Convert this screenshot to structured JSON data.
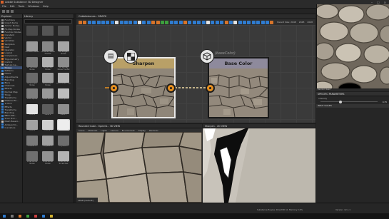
{
  "window": {
    "title": "Adobe Substance 3D Designer",
    "menu": [
      "File",
      "Edit",
      "Tools",
      "Windows",
      "Help"
    ]
  },
  "explorer": {
    "tab_label": "Explorer",
    "items": [
      {
        "label": "Functions",
        "color": "#8a8a8a"
      },
      {
        "label": "Graph Items",
        "color": "#8a8a8a"
      },
      {
        "label": "Atomic Nodes",
        "color": "#c0c0c0"
      },
      {
        "label": "FX-Map Nodes",
        "color": "#c0c0c0"
      },
      {
        "label": "Function Nodes",
        "color": "#c0c0c0"
      },
      {
        "label": "Constant",
        "color": "#d6742a"
      },
      {
        "label": "Vector",
        "color": "#d6742a"
      },
      {
        "label": "Variables",
        "color": "#d6742a"
      },
      {
        "label": "Samplers",
        "color": "#d6742a"
      },
      {
        "label": "Cast",
        "color": "#d6742a"
      },
      {
        "label": "Operator",
        "color": "#d6742a"
      },
      {
        "label": "Logical",
        "color": "#d6742a"
      },
      {
        "label": "Comparison",
        "color": "#d6742a"
      },
      {
        "label": "Trigonometry",
        "color": "#d6742a"
      },
      {
        "label": "Control",
        "color": "#d6742a"
      },
      {
        "label": "Texture Ge...",
        "color": "#c0c0c0"
      },
      {
        "label": "Noises",
        "color": "#2f7cd0",
        "selected": true
      },
      {
        "label": "Patterns",
        "color": "#2f7cd0"
      },
      {
        "label": "Filters",
        "color": "#c0c0c0"
      },
      {
        "label": "Adjustments",
        "color": "#2f7cd0"
      },
      {
        "label": "Blending",
        "color": "#2f7cd0"
      },
      {
        "label": "Blurs",
        "color": "#2f7cd0"
      },
      {
        "label": "Channels",
        "color": "#2f7cd0"
      },
      {
        "label": "Effects",
        "color": "#2f7cd0"
      },
      {
        "label": "Normal Map",
        "color": "#2f7cd0"
      },
      {
        "label": "Tiling",
        "color": "#2f7cd0"
      },
      {
        "label": "Transforms",
        "color": "#2f7cd0"
      },
      {
        "label": "Material Fil...",
        "color": "#c0c0c0"
      },
      {
        "label": "1-Click",
        "color": "#2f7cd0"
      },
      {
        "label": "Effects",
        "color": "#2f7cd0"
      },
      {
        "label": "Transforms",
        "color": "#2f7cd0"
      },
      {
        "label": "Blending",
        "color": "#2f7cd0"
      },
      {
        "label": "PBR Utilit...",
        "color": "#2f7cd0"
      },
      {
        "label": "Scan Proc...",
        "color": "#2f7cd0"
      },
      {
        "label": "Mesh Based...",
        "color": "#c0c0c0"
      },
      {
        "label": "Ambient O...",
        "color": "#2f7cd0"
      },
      {
        "label": "Curvature",
        "color": "#2f7cd0"
      }
    ]
  },
  "library": {
    "tab_label": "Library",
    "items": [
      {
        "label": "",
        "color": "#4a4a4a"
      },
      {
        "label": "",
        "color": "#555555"
      },
      {
        "label": "",
        "color": "#4e4e4e"
      },
      {
        "label": "3D Perlin Noise",
        "color": "#9a9a9a"
      },
      {
        "label": "3D Perlin Noise Fractal",
        "color": "#888888"
      },
      {
        "label": "3D Ridged Noise",
        "color": "#a5a5a5"
      },
      {
        "label": "3D Simplex Noise",
        "color": "#7a7a7a"
      },
      {
        "label": "3D Worley Noise",
        "color": "#b0b0b0"
      },
      {
        "label": "3D Worley Noise Fractal",
        "color": "#8d8d8d"
      },
      {
        "label": "Anisotropic Noise",
        "color": "#6a6a6a"
      },
      {
        "label": "Anisotropic Noise",
        "color": "#9c9c9c"
      },
      {
        "label": "Blue Noise Fast",
        "color": "#b5b5b5"
      },
      {
        "label": "BnW Spots",
        "color": "#7d7d7d"
      },
      {
        "label": "BnW Spots",
        "color": "#999999"
      },
      {
        "label": "BnW Spots",
        "color": "#bdbdbd"
      },
      {
        "label": "Cells 1",
        "color": "#e2e2e2"
      },
      {
        "label": "Cells 2",
        "color": "#5d5d5d"
      },
      {
        "label": "Cells 3",
        "color": "#8f8f8f"
      },
      {
        "label": "Cells 4",
        "color": "#a2a2a2"
      },
      {
        "label": "Clouds 1",
        "color": "#cfcfcf"
      },
      {
        "label": "Clouds 2",
        "color": "#ededed",
        "selected": true
      },
      {
        "label": "Clouds 3",
        "color": "#7a7a7a"
      },
      {
        "label": "Crystal 1",
        "color": "#a0a0a0"
      },
      {
        "label": "Crystal 2",
        "color": "#6e6e6e"
      },
      {
        "label": "Directional Noise",
        "color": "#6f6f6f"
      },
      {
        "label": "Directional Noise",
        "color": "#929292"
      },
      {
        "label": "Directional Scratches",
        "color": "#b3b3b3"
      }
    ]
  },
  "graph": {
    "tab_label": "Cobblestones - GRAPH",
    "toolbar_colors": [
      "#d6742a",
      "#d6742a",
      "#2f7cd0",
      "#2f7cd0",
      "#2f7cd0",
      "#2f7cd0",
      "#2f7cd0",
      "#2f7cd0",
      "#e2e2e2",
      "#2f7cd0",
      "#2f7cd0",
      "#2f7cd0",
      "#2f7cd0",
      "#e2e2e2",
      "#2f7cd0",
      "#2f7cd0",
      "#d6742a",
      "#d6742a",
      "#3da03d",
      "#3da03d",
      "#2f7cd0",
      "#2f7cd0",
      "#2f7cd0",
      "#d6742a",
      "#2f7cd0",
      "#2f7cd0",
      "#2f7cd0",
      "#2f7cd0",
      "#e2e2e2",
      "#2f7cd0",
      "#2f7cd0",
      "#2f7cd0",
      "#d6742a",
      "#2f7cd0",
      "#e2e2e2",
      "#2f7cd0",
      "#2f7cd0",
      "#2f7cd0",
      "#2f7cd0",
      "#2f7cd0",
      "#2f7cd0",
      "#2f7cd0",
      "#d6742a"
    ],
    "parent_size_label": "Parent Size: 2048",
    "size_a": "2048",
    "size_b": "2048",
    "nodes": {
      "sharpen": {
        "title": "Sharpen",
        "header_color": "#b9a067",
        "icon_left": "document-icon",
        "icon_right": "checker-icon"
      },
      "base_color": {
        "title": "Base Color",
        "header_color": "#8e8a9c",
        "caption": "(baseColor)",
        "icon": "cube-icon"
      }
    }
  },
  "view2d": {
    "status": "Random Seed"
  },
  "params": {
    "tab_label": "SPECIFIC PARAMETERS",
    "section_intensity": "Intensity",
    "intensity_value": "0.35",
    "intensity_level": 0.35,
    "section_input": "INPUT VALUES"
  },
  "view3d": {
    "tab_label": "Rounded Cube - OpenGL - 3D VIEW",
    "menu": [
      "Scene",
      "Materials",
      "Lights",
      "Camera",
      "Environment",
      "Display",
      "Renderer"
    ],
    "footer": "sRGB (default)"
  },
  "view2d_small": {
    "tab_label": "Sharpen - 2D VIEW"
  },
  "status": {
    "left": "",
    "mid": "Substance Engine: Direct3D 11",
    "memory": "Memory: 10%",
    "version": "Version: 12.1.1"
  }
}
